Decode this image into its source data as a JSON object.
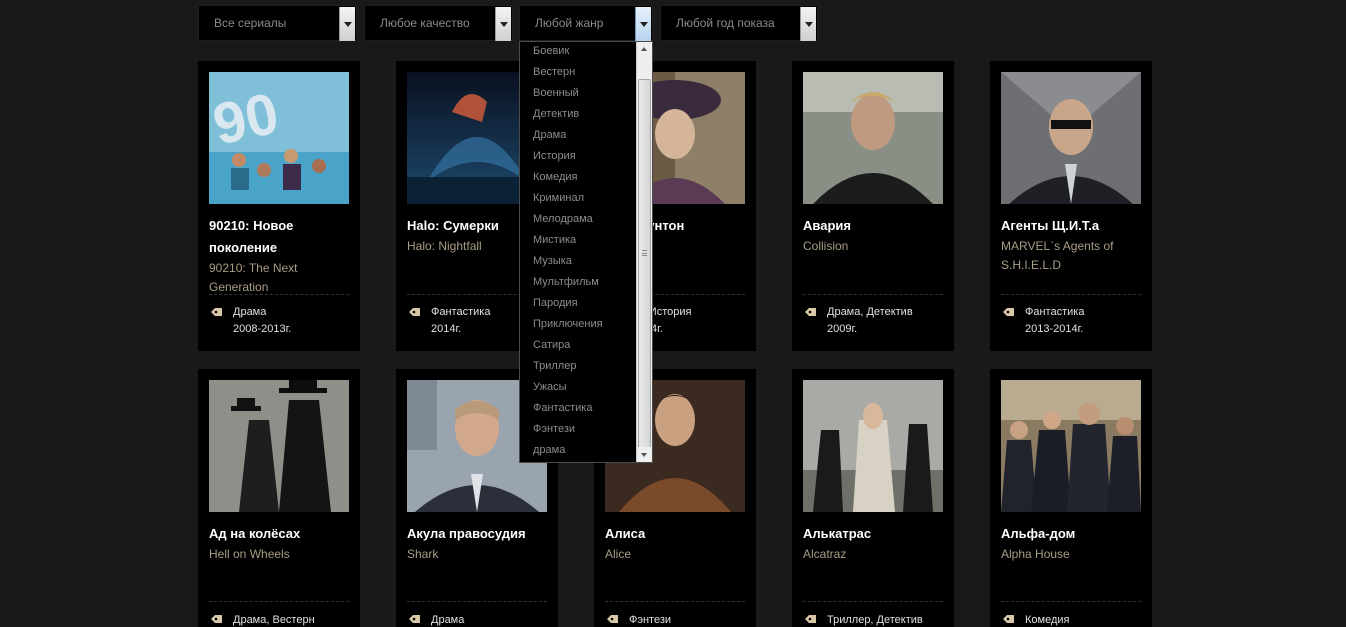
{
  "filters": {
    "series": "Все сериалы",
    "quality": "Любое качество",
    "genre": "Любой жанр",
    "year": "Любой год показа"
  },
  "genre_options": [
    "Боевик",
    "Вестерн",
    "Военный",
    "Детектив",
    "Драма",
    "История",
    "Комедия",
    "Криминал",
    "Мелодрама",
    "Мистика",
    "Музыка",
    "Мультфильм",
    "Пародия",
    "Приключения",
    "Сатира",
    "Триллер",
    "Ужасы",
    "Фантастика",
    "Фэнтези",
    "драма"
  ],
  "shows_row1": [
    {
      "title": "90210: Новое поколение",
      "original": "90210: The Next Generation",
      "genre": "Драма",
      "years": "2008-2013г."
    },
    {
      "title": "Halo: Сумерки",
      "original": "Halo: Nightfall",
      "genre": "Фантастика",
      "years": "2014г."
    },
    {
      "title": "тво Даунтон",
      "original": "n Abbey",
      "genre": "ма, История",
      "years": "-2014г."
    },
    {
      "title": "Авария",
      "original": "Collision",
      "genre": "Драма, Детектив",
      "years": "2009г."
    },
    {
      "title": "Агенты Щ.И.Т.а",
      "original": "MARVEL`s Agents of S.H.I.E.L.D",
      "genre": "Фантастика",
      "years": "2013-2014г."
    }
  ],
  "shows_row2": [
    {
      "title": "Ад на колёсах",
      "original": "Hell on Wheels",
      "genre": "Драма, Вестерн"
    },
    {
      "title": "Акула правосудия",
      "original": "Shark",
      "genre": "Драма"
    },
    {
      "title": "Алиса",
      "original": "Alice",
      "genre": "Фэнтези"
    },
    {
      "title": "Алькатрас",
      "original": "Alcatraz",
      "genre": "Триллер, Детектив"
    },
    {
      "title": "Альфа-дом",
      "original": "Alpha House",
      "genre": "Комедия"
    }
  ],
  "icons": {
    "tag": "price-tag-icon",
    "dropdown_arrow": "chevron-down-icon"
  }
}
